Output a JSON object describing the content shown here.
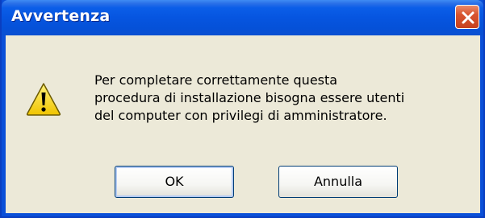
{
  "dialog": {
    "title": "Avvertenza",
    "message_lines": [
      "Per completare correttamente questa",
      "procedura di installazione bisogna essere utenti",
      "del computer con privilegi di amministratore."
    ],
    "icon": "warning-icon",
    "buttons": {
      "ok_label": "OK",
      "cancel_label": "Annulla"
    }
  },
  "colors": {
    "titlebar": "#0655e0",
    "client_background": "#ece9d8",
    "close_button": "#d8542e",
    "warning_yellow": "#f5d30a"
  }
}
